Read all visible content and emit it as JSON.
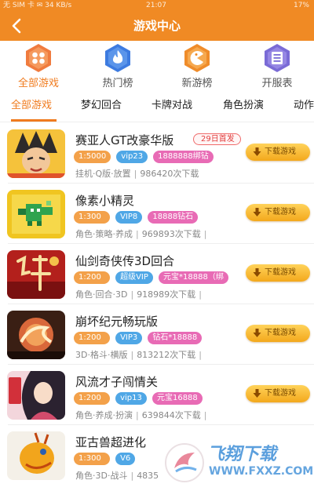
{
  "status_bar": {
    "left": "无 SIM 卡 ✉ 34 KB/s",
    "time": "21:07",
    "battery": "17%"
  },
  "header": {
    "title": "游戏中心",
    "back_icon": "back-arrow-icon"
  },
  "quick_tabs": [
    {
      "label": "全部游戏",
      "icon": "grid-icon",
      "active": true
    },
    {
      "label": "热门榜",
      "icon": "flame-icon",
      "active": false
    },
    {
      "label": "新游榜",
      "icon": "pacman-icon",
      "active": false
    },
    {
      "label": "开服表",
      "icon": "list-icon",
      "active": false
    }
  ],
  "category_tabs": [
    "全部游戏",
    "梦幻回合",
    "卡牌对战",
    "角色扮演",
    "动作"
  ],
  "colors": {
    "accent": "#f08a24",
    "active_text": "#f07b1e",
    "vip": "#4fa7e6",
    "gift": "#e86bb5",
    "discount": "#f3a14a"
  },
  "download_label": "下载游戏",
  "games": [
    {
      "name": "赛亚人GT改豪华版",
      "tag": "29日首发",
      "discount": "1:5000",
      "vip": "vip23",
      "gift": "1888888绑钻",
      "genre": "挂机·Q版·放置",
      "downloads": "986420次下载"
    },
    {
      "name": "像素小精灵",
      "tag": "",
      "discount": "1:300",
      "vip": "VIP8",
      "gift": "18888钻石",
      "genre": "角色·策略·养成",
      "downloads": "969893次下载"
    },
    {
      "name": "仙剑奇侠传3D回合",
      "tag": "",
      "discount": "1:200",
      "vip": "超级VIP",
      "gift": "元宝*18888（绑",
      "genre": "角色·回合·3D",
      "downloads": "918989次下载"
    },
    {
      "name": "崩坏纪元畅玩版",
      "tag": "",
      "discount": "1:200",
      "vip": "VIP3",
      "gift": "钻石*18888",
      "genre": "3D·格斗·横版",
      "downloads": "813212次下载"
    },
    {
      "name": "风流才子闯情关",
      "tag": "",
      "discount": "1:200",
      "vip": "vip13",
      "gift": "元宝16888",
      "genre": "角色·养成·扮演",
      "downloads": "639844次下载"
    },
    {
      "name": "亚古兽超进化",
      "tag": "",
      "discount": "1:300",
      "vip": "V6",
      "gift": "",
      "genre": "角色·3D·战斗",
      "downloads": "4835"
    }
  ],
  "watermark": {
    "text": "飞翔下载",
    "url": "WWW.FXXZ.COM"
  }
}
